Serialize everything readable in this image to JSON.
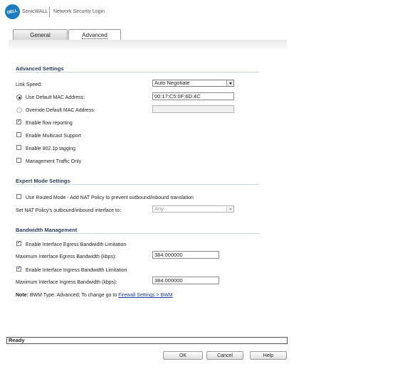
{
  "header": {
    "logo_text": "DELL",
    "brand": "SonicWALL",
    "title": "Network Security Login"
  },
  "tabs": [
    {
      "label": "General",
      "selected": false
    },
    {
      "label": "Advanced",
      "selected": true
    }
  ],
  "advanced_settings": {
    "title": "Advanced Settings",
    "link_speed_label": "Link Speed:",
    "link_speed_value": "Auto Negotiate",
    "use_default_mac_label": "Use Default MAC Address:",
    "default_mac_value": "00:17:C5:0F:6D:4C",
    "override_mac_label": "Override Default MAC Address:",
    "override_mac_value": "",
    "enable_flow_reporting": "Enable flow reporting",
    "enable_multicast": "Enable Multicast Support",
    "enable_8021p": "Enable 802.1p tagging",
    "management_traffic_only": "Management Traffic Only"
  },
  "expert_mode": {
    "title": "Expert Mode Settings",
    "routed_mode_label": "Use Routed Mode - Add NAT Policy to prevent outbound/inbound translation",
    "nat_interface_label": "Set NAT Policy's outbound/inbound interface to:",
    "nat_interface_value": "Any"
  },
  "bandwidth": {
    "title": "Bandwidth Management",
    "egress_enable_label": "Enable Interface Egress Bandwidth Limitation",
    "egress_max_label": "Maximum Interface Egress Bandwidth (kbps):",
    "egress_value": "384.000000",
    "ingress_enable_label": "Enable Interface Ingress Bandwidth Limitation",
    "ingress_max_label": "Maximum Interface Ingress Bandwidth (kbps):",
    "ingress_value": "384.000000",
    "note_prefix": "Note:",
    "note_text": "BWM Type: Advanced; To change go to",
    "note_link": "Firewall Settings > BWM"
  },
  "status": {
    "text": "Ready"
  },
  "buttons": {
    "ok": "OK",
    "cancel": "Cancel",
    "help": "Help"
  }
}
